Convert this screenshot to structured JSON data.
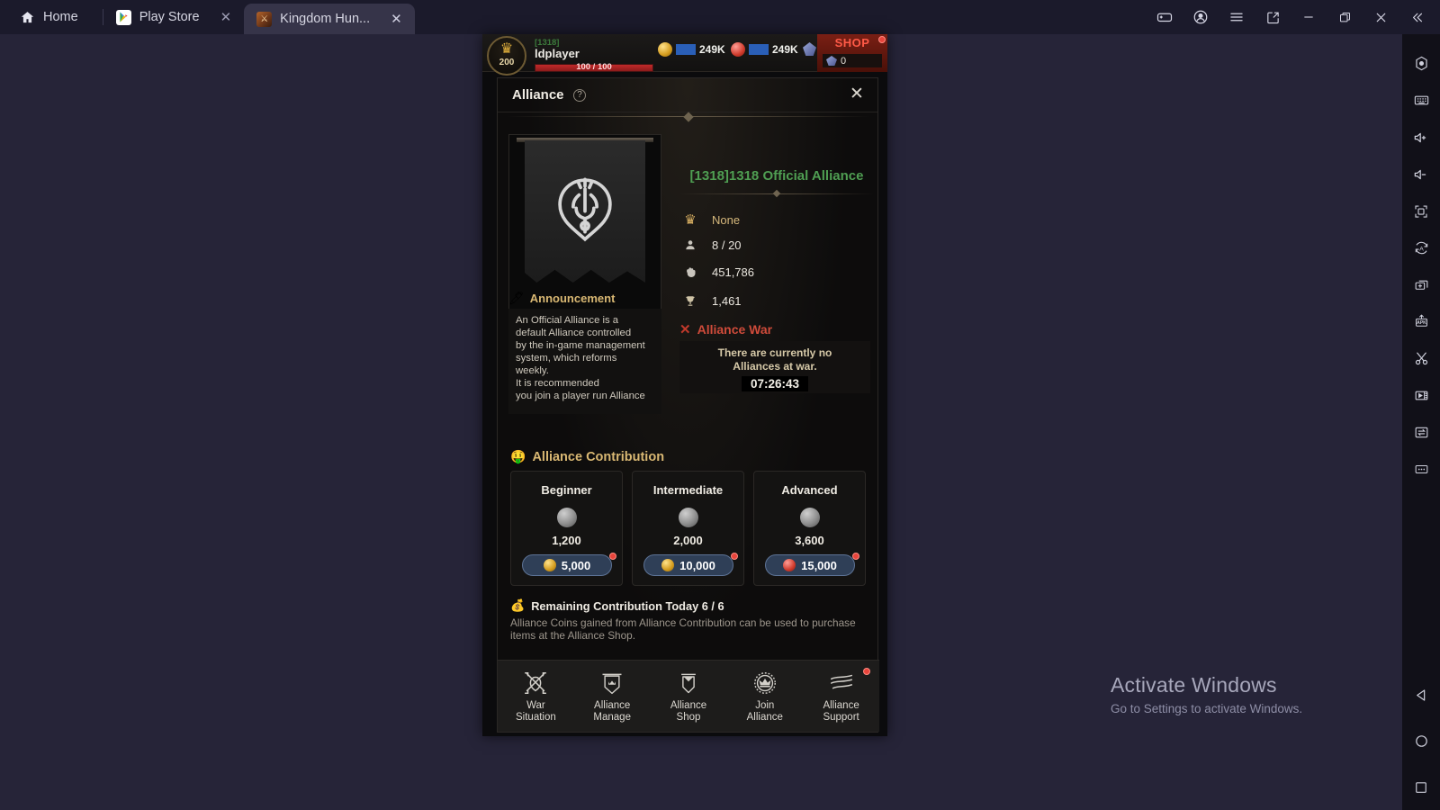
{
  "titlebar": {
    "tabs": [
      {
        "label": "Home",
        "icon": "home-icon",
        "closable": false,
        "active": false
      },
      {
        "label": "Play Store",
        "icon": "play-store-icon",
        "closable": true,
        "active": false
      },
      {
        "label": "Kingdom Hun...",
        "icon": "game-icon",
        "closable": true,
        "active": true
      }
    ],
    "close_glyph": "✕",
    "window_buttons": [
      {
        "name": "gamepad-icon"
      },
      {
        "name": "account-icon"
      },
      {
        "name": "menu-icon"
      },
      {
        "name": "popout-icon"
      },
      {
        "name": "minimize-icon"
      },
      {
        "name": "maximize-icon"
      },
      {
        "name": "close-icon"
      },
      {
        "name": "collapse-sidebar-icon"
      }
    ]
  },
  "sidebar": {
    "items": [
      {
        "name": "settings-hex-icon"
      },
      {
        "name": "keyboard-icon"
      },
      {
        "name": "volume-up-icon"
      },
      {
        "name": "volume-down-icon"
      },
      {
        "name": "fullscreen-icon"
      },
      {
        "name": "auto-rotate-icon"
      },
      {
        "name": "multi-instance-icon"
      },
      {
        "name": "install-apk-icon"
      },
      {
        "name": "scissors-icon"
      },
      {
        "name": "video-record-icon"
      },
      {
        "name": "file-transfer-icon"
      },
      {
        "name": "more-options-icon"
      }
    ],
    "nav": [
      {
        "name": "android-back-icon"
      },
      {
        "name": "android-home-icon"
      },
      {
        "name": "android-recents-icon"
      }
    ]
  },
  "watermark": {
    "line1": "Activate Windows",
    "line2": "Go to Settings to activate Windows."
  },
  "game": {
    "player": {
      "level": "200",
      "tag": "[1318]",
      "name": "ldplayer",
      "hp": "100 / 100",
      "resources": [
        {
          "icon": "gold-coin-icon",
          "value": "249K"
        },
        {
          "icon": "red-coin-icon",
          "value": "249K"
        },
        {
          "icon": "gem-icon",
          "value": "0"
        }
      ],
      "shop": {
        "label": "SHOP",
        "gems": "0"
      }
    },
    "dialog": {
      "title": "Alliance",
      "help_glyph": "?",
      "close_glyph": "✕",
      "alliance_name": "[1318]1318 Official Alliance",
      "stats": [
        {
          "icon": "crown-icon",
          "glyph": "♛",
          "label": "None",
          "is_none": true
        },
        {
          "icon": "members-icon",
          "glyph": "♟",
          "label": "8 / 20",
          "is_none": false
        },
        {
          "icon": "power-fist-icon",
          "glyph": "✊",
          "label": "451,786",
          "is_none": false
        },
        {
          "icon": "trophy-icon",
          "glyph": "♙",
          "label": "1,461",
          "is_none": false
        }
      ],
      "announcement": {
        "icon": "quill-icon",
        "title": "Announcement",
        "body": "An Official Alliance is a\ndefault Alliance controlled\nby the in-game management\nsystem, which reforms\nweekly.\nIt is recommended\nyou join a player run Alliance"
      },
      "war": {
        "icon": "red-x-icon",
        "title": "Alliance War",
        "message": "There are currently no\nAlliances at war.",
        "timer": "07:26:43"
      },
      "contribution": {
        "icon": "contribution-hand-icon",
        "title": "Alliance Contribution",
        "cards": [
          {
            "tier": "Beginner",
            "reward": "1,200",
            "cost": "5,000",
            "cost_icon": "gold-coin-icon",
            "has_badge": true
          },
          {
            "tier": "Intermediate",
            "reward": "2,000",
            "cost": "10,000",
            "cost_icon": "gold-coin-icon",
            "has_badge": true
          },
          {
            "tier": "Advanced",
            "reward": "3,600",
            "cost": "15,000",
            "cost_icon": "red-coin-icon",
            "has_badge": true
          }
        ],
        "remaining_icon": "money-bag-icon",
        "remaining_label": "Remaining Contribution Today 6 / 6",
        "note": "Alliance Coins gained from Alliance Contribution can be used to purchase items at the Alliance Shop."
      },
      "bottom_nav": [
        {
          "icon": "crossed-swords-icon",
          "label": "War\nSituation",
          "badge": false
        },
        {
          "icon": "alliance-banner-icon",
          "label": "Alliance\nManage",
          "badge": false
        },
        {
          "icon": "alliance-shop-icon",
          "label": "Alliance\nShop",
          "badge": false
        },
        {
          "icon": "join-crown-icon",
          "label": "Join\nAlliance",
          "badge": false
        },
        {
          "icon": "alliance-support-icon",
          "label": "Alliance\nSupport",
          "badge": true
        }
      ]
    }
  },
  "colors": {
    "accent_gold": "#d9b873",
    "alliance_green": "#4f9e52",
    "war_red": "#cf4b3a",
    "badge_red": "#e8453c",
    "shop_red": "#ff5a47"
  }
}
